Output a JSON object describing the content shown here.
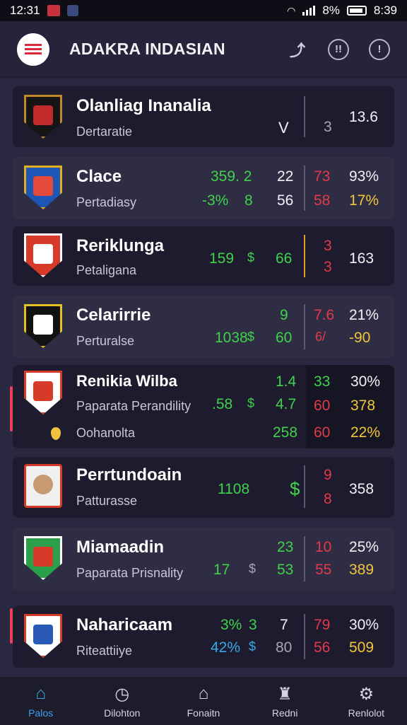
{
  "status": {
    "time": "12:31",
    "battery": "8%",
    "clock": "8:39"
  },
  "app": {
    "title": "ADAKRA INDASIAN",
    "icons": [
      "share-icon",
      "stats-icon",
      "info-icon"
    ]
  },
  "rows": [
    {
      "name": "Olanliag Inanalia",
      "sub": "Dertaratie",
      "mark": "V",
      "n1": "3",
      "n2": "13.6"
    },
    {
      "name": "Clace",
      "sub": "Pertadiasy",
      "v1": "359. 2",
      "v2": "22",
      "v3": "73",
      "v4": "93%",
      "v5": "-3%",
      "v6": "8",
      "v7": "56",
      "v8": "58",
      "v9": "17%"
    },
    {
      "name": "Reriklunga",
      "sub": "Petaligana",
      "v1": "159",
      "sym": "$",
      "v2": "66",
      "v3": "3",
      "v4": "3",
      "v5": "163"
    },
    {
      "name": "Celarirrie",
      "sub": "Perturalse",
      "v1": "9",
      "v2": "7.6",
      "v3": "21%",
      "v4": "1038",
      "sym": "$",
      "v5": "60",
      "v6": "6/",
      "v7": "-90"
    },
    {
      "name": "Renikia Wilba",
      "sub": "Paparata Perandility",
      "sub2": "Oohanolta",
      "v1": "1.4",
      "v2": "33",
      "v3": "30%",
      "v4": ".58",
      "sym": "$",
      "v5": "4.7",
      "v6": "60",
      "v7": "378",
      "v8": "258",
      "v9": "60",
      "v10": "22%"
    },
    {
      "name": "Perrtundoain",
      "sub": "Patturasse",
      "v1": "1108",
      "v2": "$",
      "v3": "9",
      "v4": "8",
      "v5": "358"
    },
    {
      "name": "Miamaadin",
      "sub": "Paparata Prisnality",
      "v1": "23",
      "v2": "10",
      "v3": "25%",
      "v4": "17",
      "sym": "$",
      "v5": "53",
      "v6": "55",
      "v7": "389"
    },
    {
      "name": "Naharicaam",
      "sub": "Riteattiiye",
      "v1": "3%",
      "v2": "3",
      "v3": "7",
      "v4": "79",
      "v5": "30%",
      "v6": "42%",
      "sym": "$",
      "v7": "80",
      "v8": "56",
      "v9": "509"
    }
  ],
  "nav": [
    {
      "label": "Palos",
      "icon": "home-icon",
      "glyph": "⌂",
      "active": true
    },
    {
      "label": "Dilohton",
      "icon": "timer-icon",
      "glyph": "◷",
      "active": false
    },
    {
      "label": "Fonaitn",
      "icon": "house-icon",
      "glyph": "⌂",
      "active": false
    },
    {
      "label": "Redni",
      "icon": "trophy-icon",
      "glyph": "♜",
      "active": false
    },
    {
      "label": "Renlolot",
      "icon": "gear-icon",
      "glyph": "⚙",
      "active": false
    }
  ]
}
